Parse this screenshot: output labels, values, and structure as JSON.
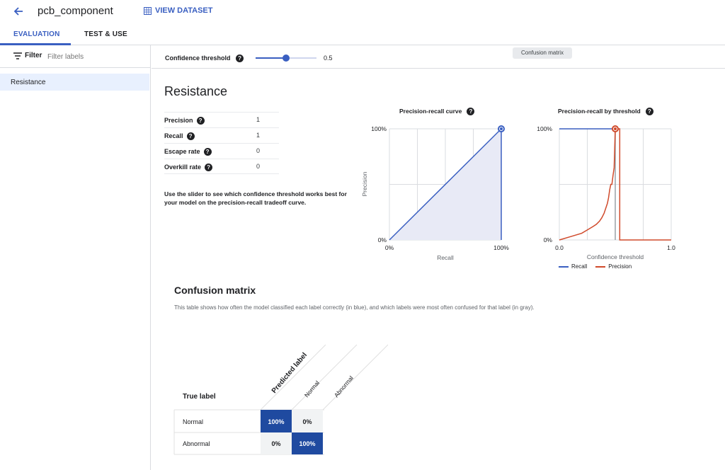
{
  "header": {
    "title": "pcb_component",
    "view_dataset": "VIEW DATASET"
  },
  "tabs": [
    {
      "label": "EVALUATION",
      "active": true
    },
    {
      "label": "TEST & USE",
      "active": false
    }
  ],
  "sidebar": {
    "filter_label": "Filter",
    "filter_placeholder": "Filter labels",
    "items": [
      {
        "label": "Resistance",
        "selected": true
      }
    ]
  },
  "threshold": {
    "label": "Confidence threshold",
    "value": "0.5",
    "fraction": 0.5
  },
  "tooltip": "Confusion matrix",
  "section": {
    "title": "Resistance",
    "metrics": [
      {
        "label": "Precision",
        "value": "1"
      },
      {
        "label": "Recall",
        "value": "1"
      },
      {
        "label": "Escape rate",
        "value": "0"
      },
      {
        "label": "Overkill rate",
        "value": "0"
      }
    ],
    "hint": "Use the slider to see which confidence threshold works best for your model on the precision-recall tradeoff curve."
  },
  "chart_data": [
    {
      "type": "area",
      "title": "Precision-recall curve",
      "xlabel": "Recall",
      "ylabel": "Precision",
      "x_ticks": [
        "0%",
        "100%"
      ],
      "y_ticks": [
        "0%",
        "100%"
      ],
      "xlim": [
        0,
        1
      ],
      "ylim": [
        0,
        1
      ],
      "series": [
        {
          "x": [
            0,
            1,
            1
          ],
          "y": [
            0,
            1,
            0
          ]
        }
      ],
      "marker": {
        "x": 1,
        "y": 1
      }
    },
    {
      "type": "line",
      "title": "Precision-recall by threshold",
      "xlabel": "Confidence threshold",
      "x_ticks": [
        "0.0",
        "1.0"
      ],
      "y_ticks": [
        "0%",
        "100%"
      ],
      "xlim": [
        0,
        1
      ],
      "ylim": [
        0,
        1
      ],
      "threshold_marker": 0.5,
      "series": [
        {
          "name": "Recall",
          "color": "#3a5fc1",
          "x": [
            0,
            0.5
          ],
          "y": [
            1,
            1
          ]
        },
        {
          "name": "Precision",
          "color": "#d04a2b",
          "x": [
            0,
            0.1,
            0.2,
            0.25,
            0.3,
            0.33,
            0.36,
            0.38,
            0.4,
            0.42,
            0.43,
            0.44,
            0.45,
            0.46,
            0.47,
            0.48,
            0.49,
            0.5,
            0.52,
            0.54,
            0.54,
            0.6,
            0.8,
            1.0
          ],
          "y": [
            0,
            0.03,
            0.06,
            0.09,
            0.12,
            0.14,
            0.17,
            0.2,
            0.24,
            0.3,
            0.33,
            0.38,
            0.45,
            0.5,
            0.5,
            0.58,
            0.65,
            1,
            1,
            1,
            0,
            0,
            0,
            0
          ]
        }
      ],
      "marker": {
        "x": 0.5,
        "y": 1
      }
    }
  ],
  "confusion": {
    "title": "Confusion matrix",
    "description": "This table shows how often the model classified each label correctly (in blue), and which labels were most often confused for that label (in gray).",
    "true_label": "True label",
    "predicted_label": "Predicted label",
    "columns": [
      "Normal",
      "Abnormal"
    ],
    "rows": [
      {
        "label": "Normal",
        "cells": [
          "100%",
          "0%"
        ],
        "diagonal_index": 0
      },
      {
        "label": "Abnormal",
        "cells": [
          "0%",
          "100%"
        ],
        "diagonal_index": 1
      }
    ],
    "colors": {
      "diagonal": "#1f4aa0",
      "offdiag": "#f1f3f4"
    }
  },
  "legend": [
    {
      "name": "Recall",
      "color": "#3a5fc1"
    },
    {
      "name": "Precision",
      "color": "#d04a2b"
    }
  ]
}
